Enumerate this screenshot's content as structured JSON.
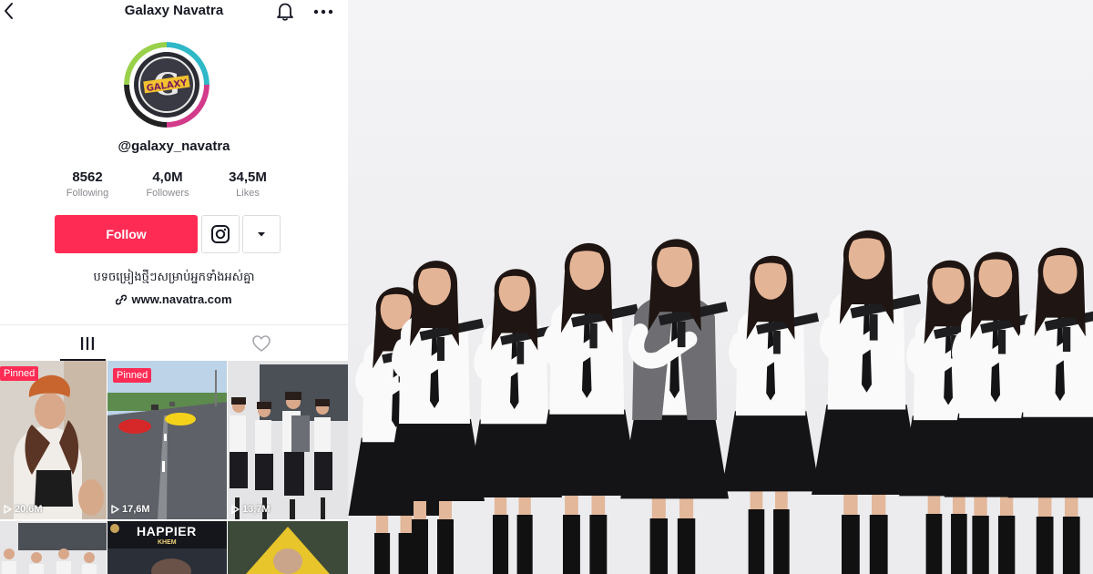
{
  "profile": {
    "title": "Galaxy Navatra",
    "username": "@galaxy_navatra",
    "avatar_text": "GALAXY",
    "stats": [
      {
        "value": "8562",
        "label": "Following"
      },
      {
        "value": "4,0M",
        "label": "Followers"
      },
      {
        "value": "34,5M",
        "label": "Likes"
      }
    ],
    "follow_label": "Follow",
    "bio": "បទចម្រៀងថ្មីៗសម្រាប់អ្នកទាំងអស់គ្នា",
    "link": "www.navatra.com",
    "colors": {
      "accent": "#fe2c55",
      "text": "#161823",
      "muted": "#8a8b91"
    }
  },
  "icons": {
    "back": "chevron-left-icon",
    "bell": "bell-icon",
    "more": "more-horizontal-icon",
    "instagram": "instagram-icon",
    "dropdown": "caret-down-icon",
    "link": "link-icon",
    "videos_tab": "grid-icon",
    "liked_tab": "heart-icon",
    "play": "play-icon"
  },
  "videos": [
    {
      "pinned": "Pinned",
      "views": "20,6M"
    },
    {
      "pinned": "Pinned",
      "views": "17,6M"
    },
    {
      "pinned": "",
      "views": "13,7M"
    },
    {
      "pinned": "",
      "views": ""
    },
    {
      "pinned": "",
      "views": "",
      "title": "HAPPIER",
      "subtitle": "KHEM"
    },
    {
      "pinned": "",
      "views": ""
    }
  ]
}
